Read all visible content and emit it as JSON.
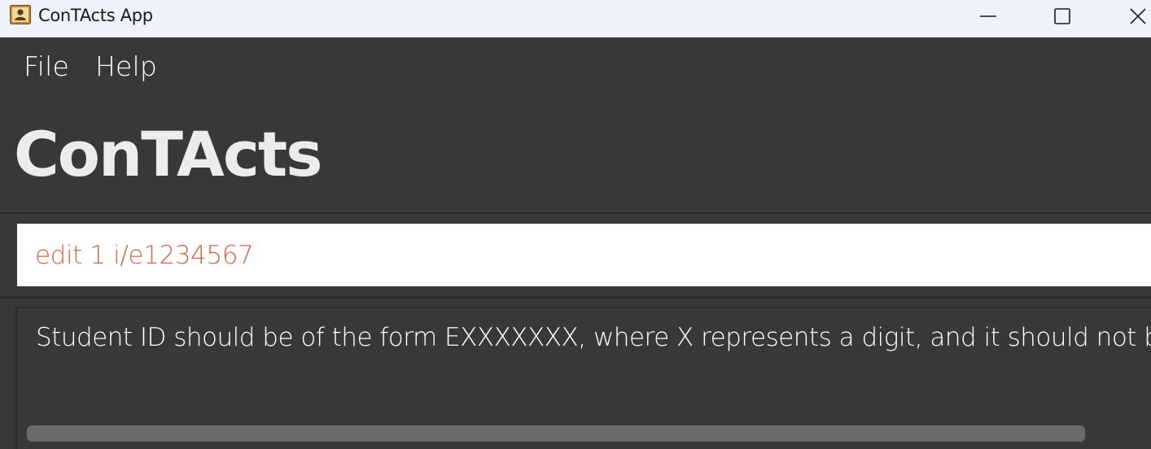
{
  "window": {
    "title": "ConTActs App",
    "icon": "contact-book-icon",
    "controls": {
      "minimize": "minimize-icon",
      "maximize": "maximize-icon",
      "close": "close-icon"
    }
  },
  "menu": {
    "items": [
      {
        "label": "File"
      },
      {
        "label": "Help"
      }
    ]
  },
  "heading": "ConTActs",
  "command": {
    "value": "edit 1 i/e1234567",
    "error_color": "#d2664d"
  },
  "result": {
    "message": "Student ID should be of the form EXXXXXXX, where X represents a digit, and it should not be b"
  },
  "colors": {
    "background": "#383838",
    "titlebar": "#eef2f9",
    "heading": "#ececec",
    "scrollbar": "#6a6a6a"
  }
}
